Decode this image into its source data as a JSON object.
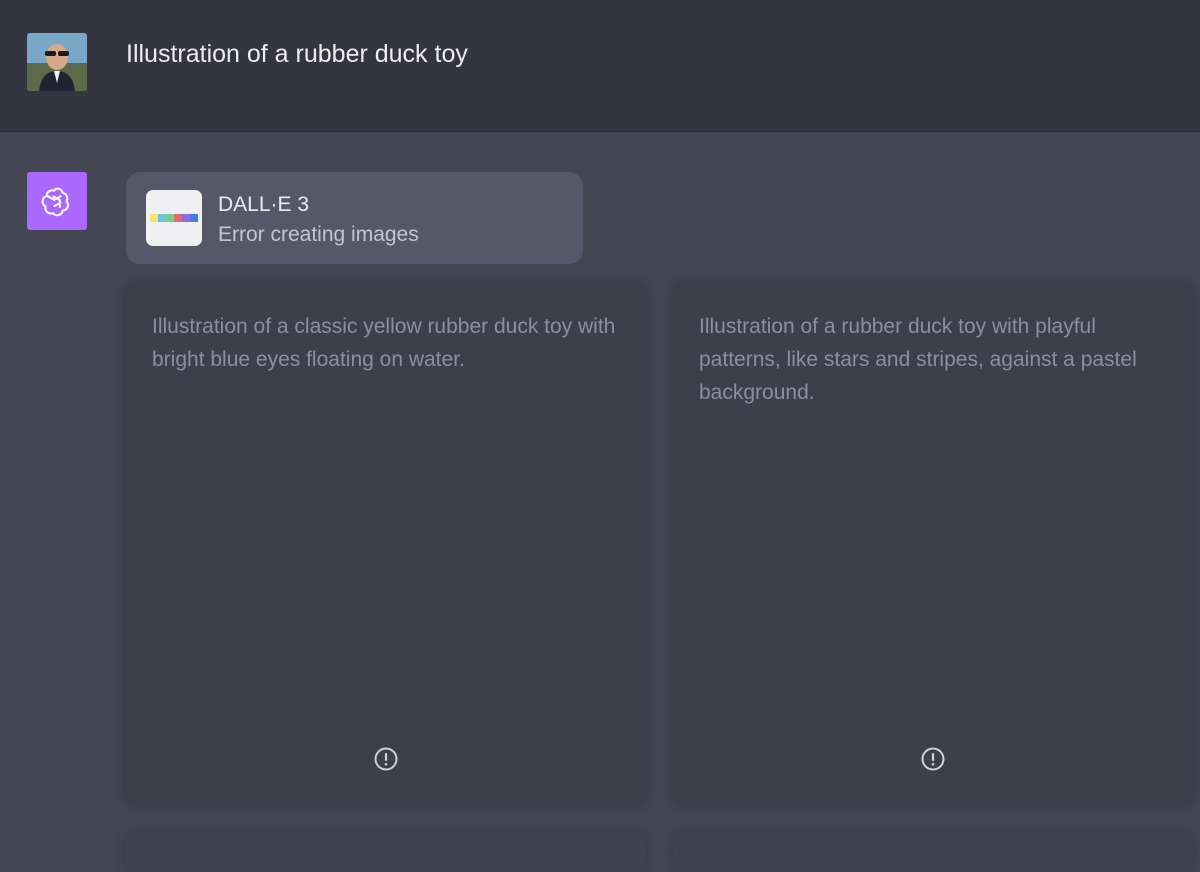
{
  "user_message": {
    "avatar_icon": "user-avatar-photo",
    "text": "Illustration of a rubber duck toy"
  },
  "assistant": {
    "icon": "openai-logo-icon",
    "icon_bg": "#ab68ff",
    "tool": {
      "name": "DALL·E 3",
      "status": "Error creating images",
      "thumb_colors": [
        "#f7e26b",
        "#67c7d9",
        "#6fd18a",
        "#e46b6b",
        "#8b6be0",
        "#4c7bd9"
      ]
    },
    "results": [
      {
        "prompt": "Illustration of a classic yellow rubber duck toy with bright blue eyes floating on water.",
        "status_icon": "error-alert-icon"
      },
      {
        "prompt": "Illustration of a rubber duck toy with playful patterns, like stars and stripes, against a pastel background.",
        "status_icon": "error-alert-icon"
      }
    ]
  }
}
